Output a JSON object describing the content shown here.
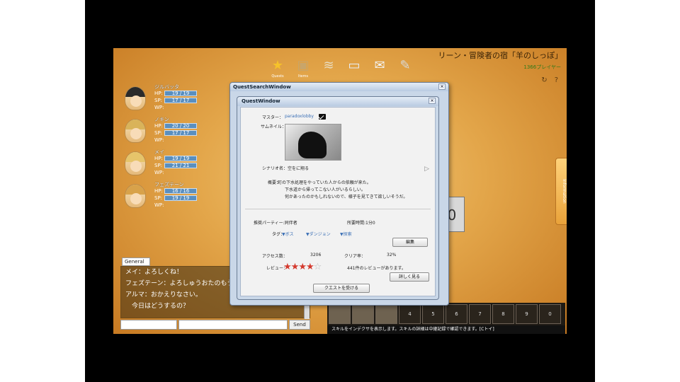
{
  "area": {
    "title": "リーン・冒険者の宿「羊のしっぽ」",
    "subtitle": "1366プレイヤー"
  },
  "toolbar": {
    "icons": [
      {
        "name": "star-icon",
        "glyph": "★",
        "color": "#f6c22a",
        "label": "Quests"
      },
      {
        "name": "box-icon",
        "glyph": "▣",
        "color": "#c8a56a",
        "label": "Items"
      },
      {
        "name": "scroll-icon",
        "glyph": "≋",
        "color": "#e8dcc0",
        "label": ""
      },
      {
        "name": "window-icon",
        "glyph": "▭",
        "color": "#e8eef8",
        "label": ""
      },
      {
        "name": "mail-icon",
        "glyph": "✉",
        "color": "#f4f4f4",
        "label": ""
      },
      {
        "name": "quill-icon",
        "glyph": "✎",
        "color": "#d8d8d8",
        "label": ""
      }
    ],
    "mini": [
      "↻",
      "?"
    ]
  },
  "side_tab": {
    "label": "Information"
  },
  "party": [
    {
      "name": "ジルバッタ",
      "hp": "19 / 19",
      "sp": "17 / 17",
      "wp": "WP:",
      "hair": "#2a2a2a"
    },
    {
      "name": "ノキン",
      "hp": "20 / 20",
      "sp": "17 / 17",
      "wp": "WP:",
      "hair": "#d9b35a"
    },
    {
      "name": "メイ",
      "hp": "19 / 19",
      "sp": "21 / 21",
      "wp": "WP:",
      "hair": "#e6c46a"
    },
    {
      "name": "フェズテーン",
      "hp": "16 / 16",
      "sp": "19 / 19",
      "wp": "WP:",
      "hair": "#d8a24a"
    }
  ],
  "labels": {
    "hp": "HP:",
    "sp": "SP:"
  },
  "chat": {
    "tab": "General",
    "lines": [
      "メイ：よろしくね！",
      "フェズテーン：よろしゅうおたのもうしまーす。",
      "アルマ：おかえりなさい。",
      "　今日はどうするの？"
    ],
    "send": "Send"
  },
  "hotbar": {
    "slots": [
      "",
      "",
      "",
      "4",
      "5",
      "6",
      "7",
      "8",
      "9",
      "0"
    ],
    "hint": "スキルをインデクサを表示します。スキルの詳細は中継記録で確認できます。[Cトイ]"
  },
  "bg_panel": {
    "glyph": "0"
  },
  "outer_window": {
    "title": "QuestSearchWindow"
  },
  "quest_window": {
    "title": "QuestWindow",
    "master_label": "マスター：",
    "master_value": "paradoxlobby",
    "thumb_label": "サムネイル：",
    "scenario_label": "シナリオ名：空をに翔る",
    "summary_label": "概要：",
    "summary_lines": [
      "町の下水処理をやっていた人からの依頼が来た。",
      "下水道から帰ってこない人がいるらしい。",
      "何かあったのかもしれないので、様子を見てきて欲しいそうだ。"
    ],
    "party_label": "推奨パーティー:同伴者",
    "time_label": "所要時間:1分0",
    "tags_label": "タグ：",
    "tags": [
      "▼ボス",
      "▼ダンジョン",
      "▼探索"
    ],
    "edit_button": "編集",
    "access_label": "アクセス数：",
    "access_value": "3206",
    "clear_label": "クリア率：",
    "clear_value": "32%",
    "review_label": "レビュー：",
    "rating": 4,
    "rating_max": 5,
    "review_count": "441件のレビューがあります。",
    "detail_button": "詳しく見る",
    "start_button": "クエストを受ける"
  }
}
